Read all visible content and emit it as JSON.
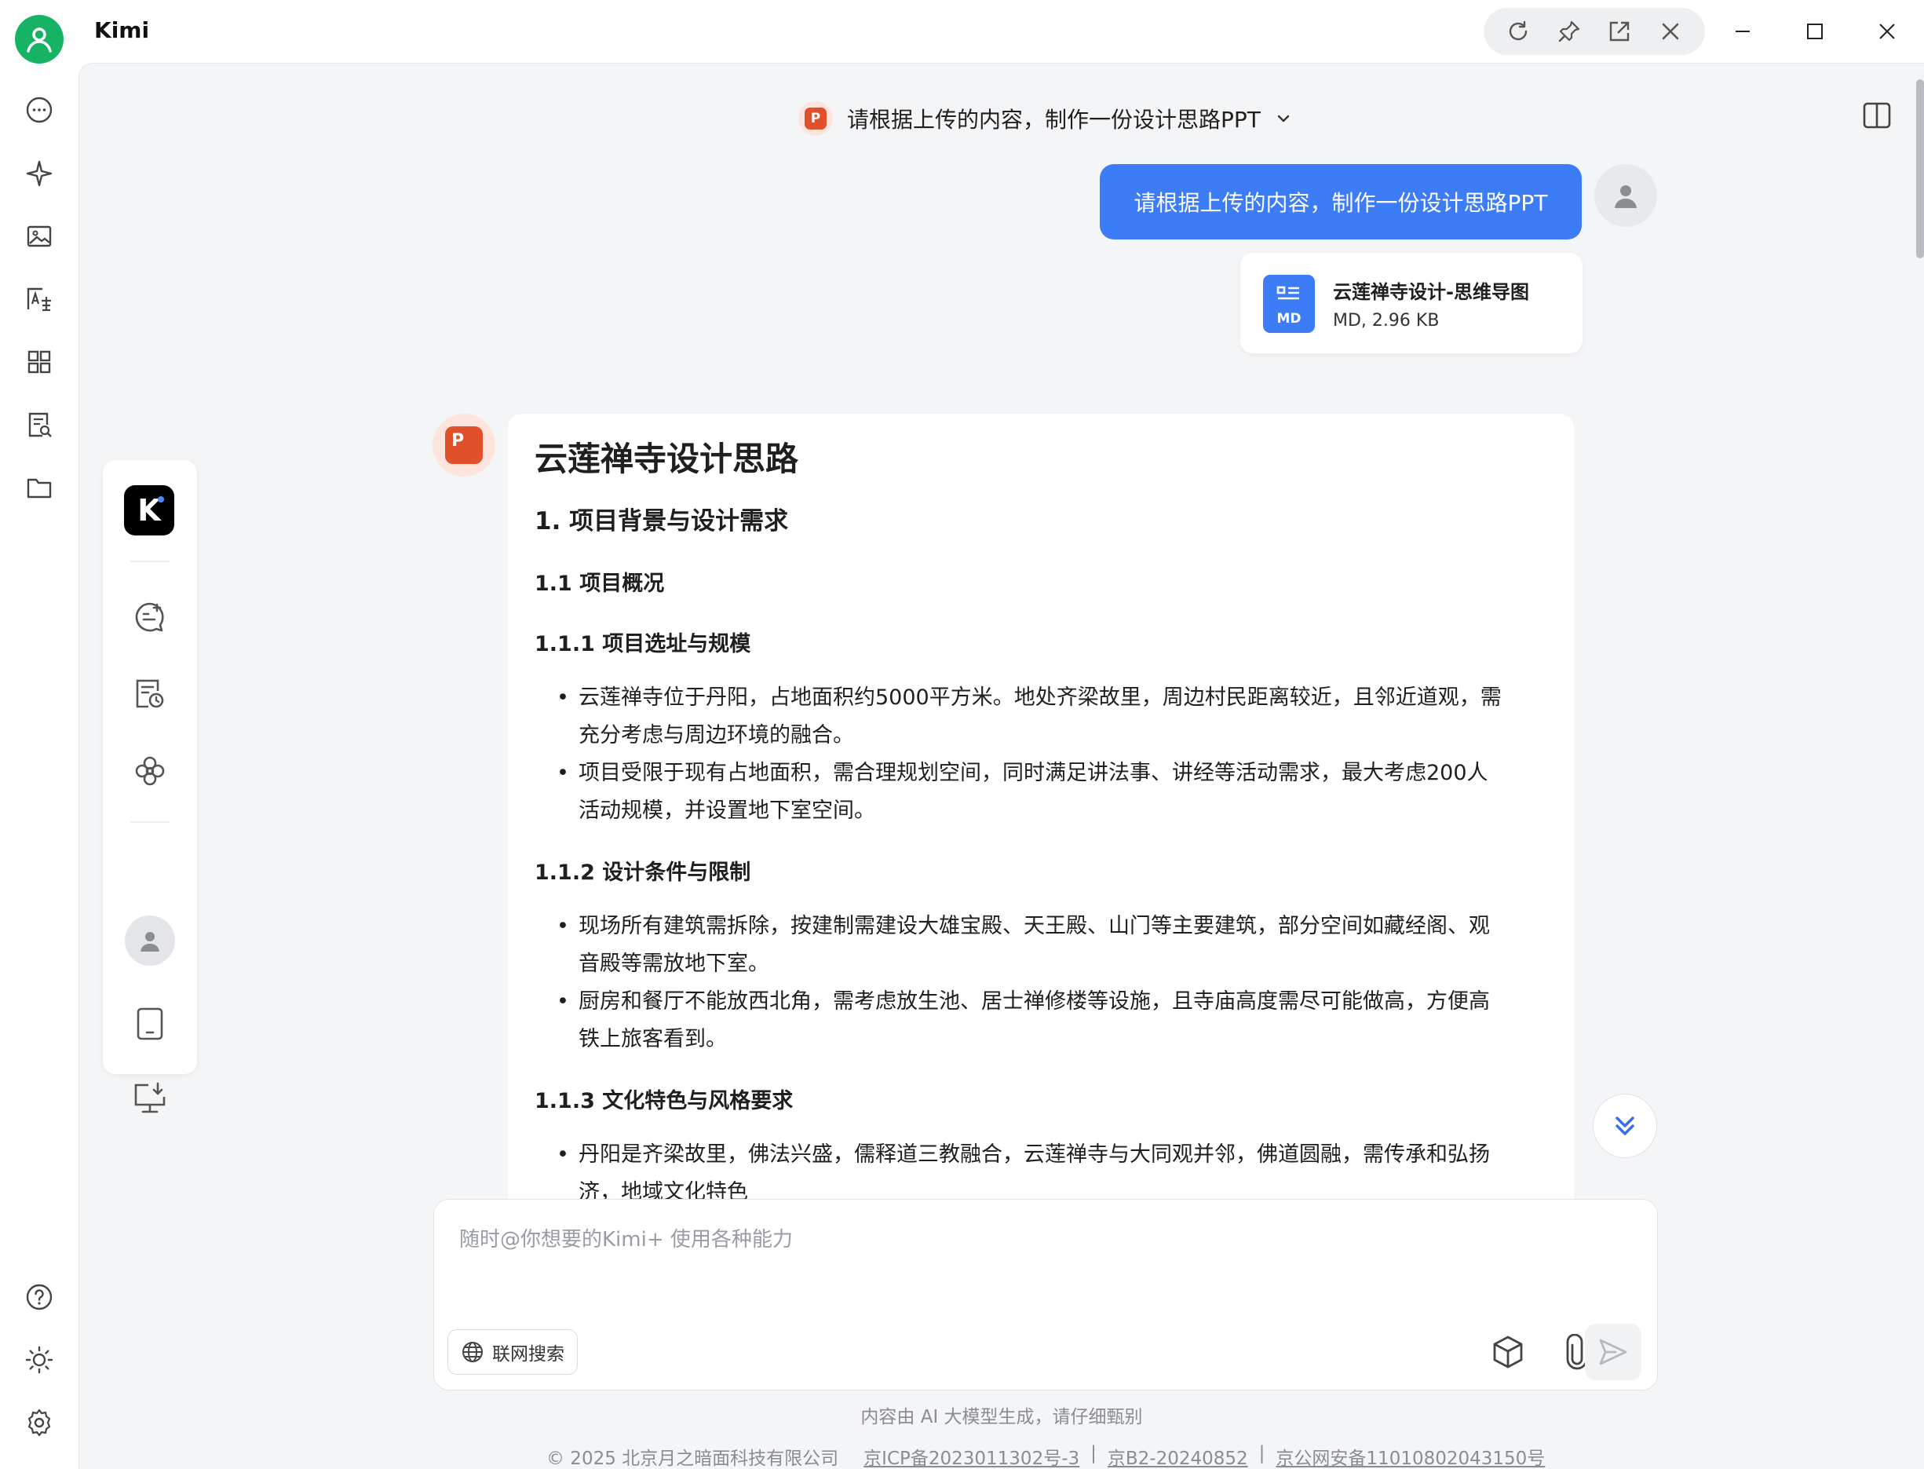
{
  "app": {
    "title": "Kimi"
  },
  "conversation": {
    "title": "请根据上传的内容，制作一份设计思路PPT"
  },
  "user_message": {
    "text": "请根据上传的内容，制作一份设计思路PPT",
    "attachment": {
      "name": "云莲禅寺设计-思维导图",
      "meta": "MD, 2.96 KB",
      "type_label": "MD"
    }
  },
  "toolcard": {
    "logo_letter": "K"
  },
  "assistant": {
    "avatar_letter": "P",
    "title": "云莲禅寺设计思路",
    "h2": "1. 项目背景与设计需求",
    "h3": "1.1 项目概况",
    "sections": [
      {
        "heading": "1.1.1 项目选址与规模",
        "bullets": [
          [
            "云莲禅寺位于丹阳，占地面积约5000平方米。地处齐梁故里，周边村民距离较近，且邻近道观，需",
            "充分考虑与周边环境的融合。"
          ],
          [
            "项目受限于现有占地面积，需合理规划空间，同时满足讲法事、讲经等活动需求，最大考虑200人",
            "活动规模，并设置地下室空间。"
          ]
        ]
      },
      {
        "heading": "1.1.2 设计条件与限制",
        "bullets": [
          [
            "现场所有建筑需拆除，按建制需建设大雄宝殿、天王殿、山门等主要建筑，部分空间如藏经阁、观",
            "音殿等需放地下室。"
          ],
          [
            "厨房和餐厅不能放西北角，需考虑放生池、居士禅修楼等设施，且寺庙高度需尽可能做高，方便高",
            "铁上旅客看到。"
          ]
        ]
      },
      {
        "heading": "1.1.3 文化特色与风格要求",
        "bullets": [
          [
            "丹阳是齐梁故里，佛法兴盛，儒释道三教融合，云莲禅寺与大同观并邻，佛道圆融，需传承和弘扬",
            "济，地域文化特色"
          ]
        ]
      }
    ]
  },
  "composer": {
    "placeholder": "随时@你想要的Kimi+ 使用各种能力",
    "web_search_label": "联网搜索"
  },
  "disclaimer": "内容由 AI 大模型生成，请仔细甄别",
  "footer": {
    "copyright": "© 2025 北京月之暗面科技有限公司",
    "links": [
      "京ICP备2023011302号-3",
      "京B2-20240852",
      "京公网安备11010802043150号"
    ],
    "separator": "|"
  },
  "colors": {
    "accent": "#3d7cf7",
    "avatar_green": "#16b364",
    "ppt_red": "#e0502a"
  }
}
